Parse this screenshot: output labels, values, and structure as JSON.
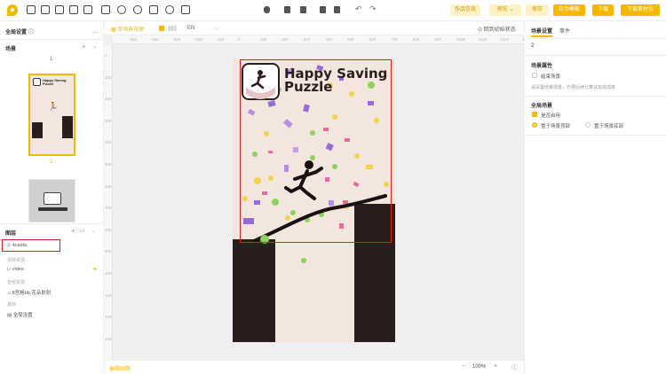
{
  "toolbar": {
    "works_preview": "作品信息",
    "preview": "预览",
    "save": "保存",
    "save_as_template": "存为模板",
    "download": "下载",
    "download_zip": "下载素材包"
  },
  "left": {
    "global_settings": "全局设置",
    "scenes_title": "场景",
    "scene_1_num": "1",
    "scene_2_num": "2",
    "layers_title": "图层",
    "layer_selected": "4cadia",
    "video_group": "视频资源",
    "video_item": "video",
    "audio_group": "音频资源",
    "audio_item": "8宫格bb,花朵射射",
    "other_group": "其他",
    "global_settings_item": "全局设置"
  },
  "center": {
    "scene_view": "单场景视图",
    "lang": "EN",
    "restore_initial": "回到初始状态",
    "edit_frame": "编辑帧数",
    "zoom": "100%",
    "ruler_h": [
      "-500",
      "-400",
      "-300",
      "-200",
      "-100",
      "0",
      "100",
      "200",
      "300",
      "400",
      "500",
      "600",
      "700",
      "800",
      "900",
      "1000",
      "1100",
      "1200",
      "1300"
    ],
    "ruler_v": [
      "0",
      "100",
      "200",
      "300",
      "400",
      "500",
      "600",
      "700",
      "800",
      "900",
      "1000",
      "1100",
      "1200",
      "1300"
    ]
  },
  "game": {
    "title_line1": "Happy Saving",
    "title_line2": "Puzzle"
  },
  "right": {
    "tab_scene_settings": "场景设置",
    "tab_events": "事件",
    "scene_number": "2",
    "scene_props_title": "场景属性",
    "end_scene": "结束场景",
    "end_scene_hint": "请设置结束场景，方便后续计算试玩完成率",
    "global_scene_title": "全局场景",
    "enable": "是否启用",
    "place_top": "置于场景顶部",
    "place_bottom": "置于场景底部"
  },
  "colors": {
    "accent": "#f5b800",
    "highlight": "#e02020",
    "stage_bg": "#f3e6df",
    "dark_block": "#2a1d1d"
  }
}
